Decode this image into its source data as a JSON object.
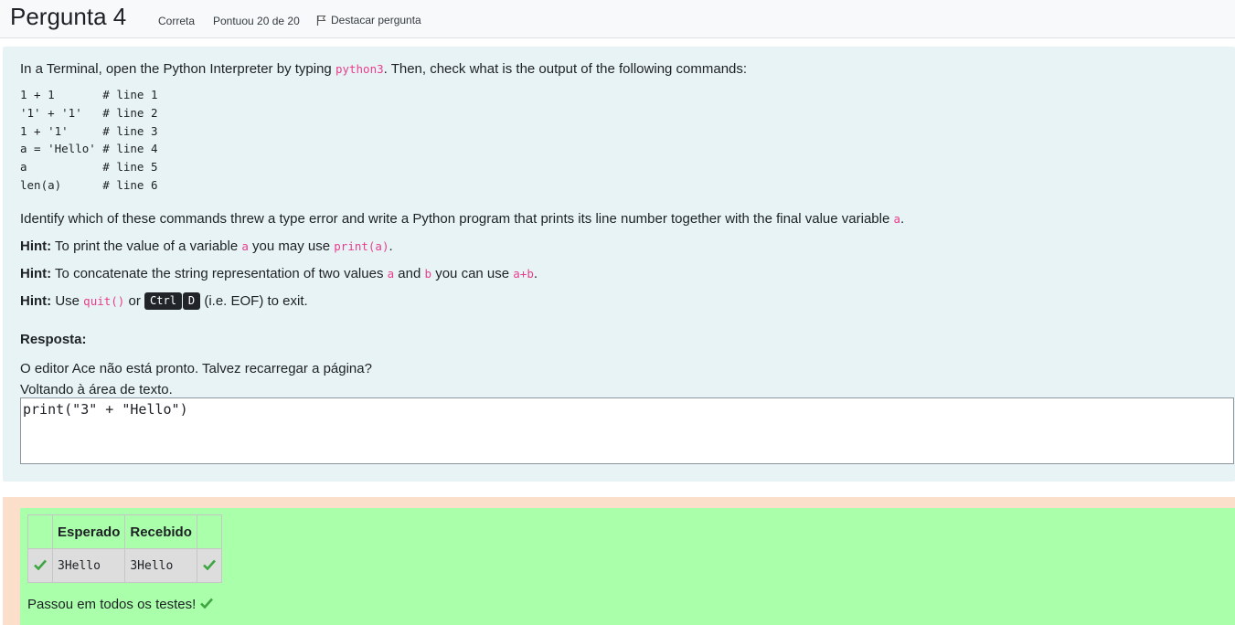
{
  "header": {
    "title": "Pergunta 4",
    "status": "Correta",
    "score": "Pontuou 20 de 20",
    "flag_label": "Destacar pergunta",
    "flag_icon": "flag-icon"
  },
  "question": {
    "intro_before": "In a Terminal, open the Python Interpreter by typing ",
    "intro_code": "python3",
    "intro_after": ". Then, check what is the output of the following commands:",
    "commands": [
      "1 + 1       # line 1",
      "'1' + '1'   # line 2",
      "1 + '1'     # line 3",
      "a = 'Hello' # line 4",
      "a           # line 5",
      "len(a)      # line 6"
    ],
    "task_before": "Identify which of these commands threw a type error and write a Python program that prints its line number together with the final value variable ",
    "task_code": "a",
    "task_after": ".",
    "hints": [
      {
        "label": "Hint:",
        "t1": " To print the value of a variable ",
        "c1": "a",
        "t2": " you may use ",
        "c2": "print(a)",
        "t3": "."
      },
      {
        "label": "Hint:",
        "t1": " To concatenate the string representation of two values ",
        "c1": "a",
        "t2": " and ",
        "c2": "b",
        "t3": " you can use ",
        "c3": "a+b",
        "t4": "."
      },
      {
        "label": "Hint:",
        "t1": " Use ",
        "c1": "quit()",
        "t2": " or ",
        "k1": "Ctrl",
        "k2": "D",
        "t3": " (i.e. EOF) to exit."
      }
    ]
  },
  "answer": {
    "label": "Resposta:",
    "ace_msg_1": "O editor Ace não está pronto. Talvez recarregar a página?",
    "ace_msg_2": "Voltando à área de texto.",
    "code": "print(\"3\" + \"Hello\")"
  },
  "results": {
    "headers": [
      "",
      "Esperado",
      "Recebido",
      ""
    ],
    "rows": [
      {
        "expected": "3Hello",
        "received": "3Hello",
        "status_icon": "check-icon"
      }
    ],
    "passed_msg": "Passou em todos os testes!"
  },
  "colors": {
    "formulation_bg": "#e7f3f5",
    "outcome_bg": "#fcdfcb",
    "pass_bg": "#aaffaa",
    "check": "#3da641",
    "code": "#e83e8c"
  }
}
